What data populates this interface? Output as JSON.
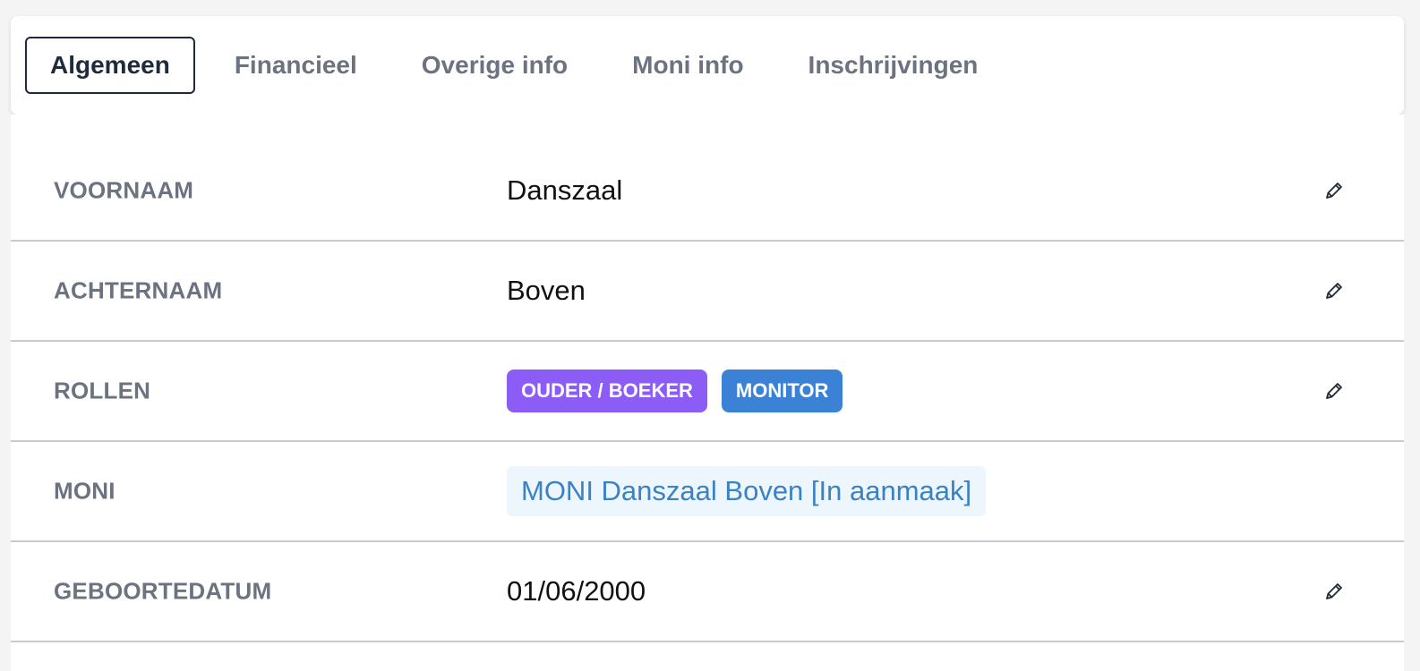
{
  "tabs": [
    {
      "label": "Algemeen",
      "active": true
    },
    {
      "label": "Financieel",
      "active": false
    },
    {
      "label": "Overige info",
      "active": false
    },
    {
      "label": "Moni info",
      "active": false
    },
    {
      "label": "Inschrijvingen",
      "active": false
    }
  ],
  "fields": {
    "voornaam": {
      "label": "VOORNAAM",
      "value": "Danszaal"
    },
    "achternaam": {
      "label": "ACHTERNAAM",
      "value": "Boven"
    },
    "rollen": {
      "label": "ROLLEN",
      "badges": [
        {
          "label": "OUDER / BOEKER",
          "color": "#8b5cf6"
        },
        {
          "label": "MONITOR",
          "color": "#3b82d6"
        }
      ]
    },
    "moni": {
      "label": "MONI",
      "link": "MONI Danszaal Boven [In aanmaak]"
    },
    "geboortedatum": {
      "label": "GEBOORTEDATUM",
      "value": "01/06/2000"
    }
  },
  "icons": {
    "edit": "pencil-icon"
  },
  "colors": {
    "label_gray": "#6b7280",
    "active_tab_border": "#1f2a3d",
    "link_blue": "#3b82c4",
    "link_bg": "#eef6fd",
    "divider": "#c7cbd1"
  }
}
